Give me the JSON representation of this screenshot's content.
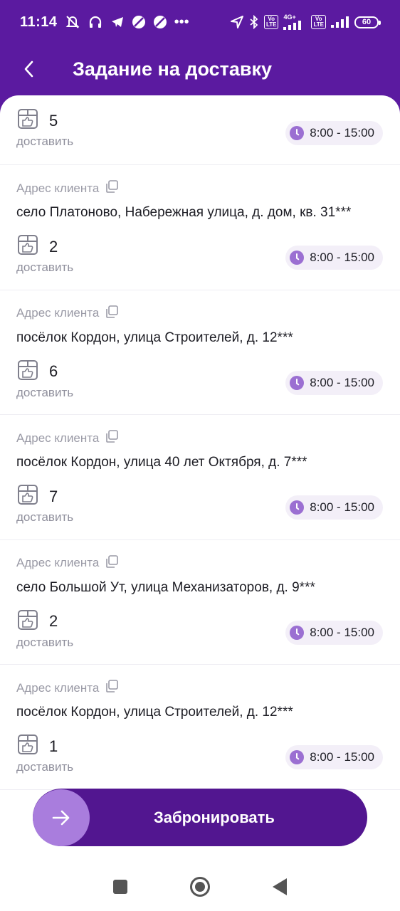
{
  "status_bar": {
    "time": "11:14",
    "dots": "•••",
    "net_top": "4G+",
    "volte": "Vo\nLTE",
    "battery": "60"
  },
  "header": {
    "title": "Задание на доставку"
  },
  "labels": {
    "address_label": "Адрес клиента",
    "deliver": "доставить"
  },
  "first_item": {
    "qty": "5",
    "time": "8:00 - 15:00"
  },
  "items": [
    {
      "address": "село Платоново, Набережная улица, д. дом, кв. 31***",
      "qty": "2",
      "time": "8:00 - 15:00"
    },
    {
      "address": "посёлок Кордон, улица Строителей, д. 12***",
      "qty": "6",
      "time": "8:00 - 15:00"
    },
    {
      "address": "посёлок Кордон, улица 40 лет Октября, д. 7***",
      "qty": "7",
      "time": "8:00 - 15:00"
    },
    {
      "address": "село Большой Ут, улица Механизаторов, д. 9***",
      "qty": "2",
      "time": "8:00 - 15:00"
    },
    {
      "address": "посёлок Кордон, улица Строителей, д. 12***",
      "qty": "1",
      "time": "8:00 - 15:00"
    }
  ],
  "actions": {
    "book_label": "Забронировать"
  },
  "colors": {
    "primary": "#5b1aa0",
    "button": "#521690",
    "accent": "#a97ddd"
  }
}
